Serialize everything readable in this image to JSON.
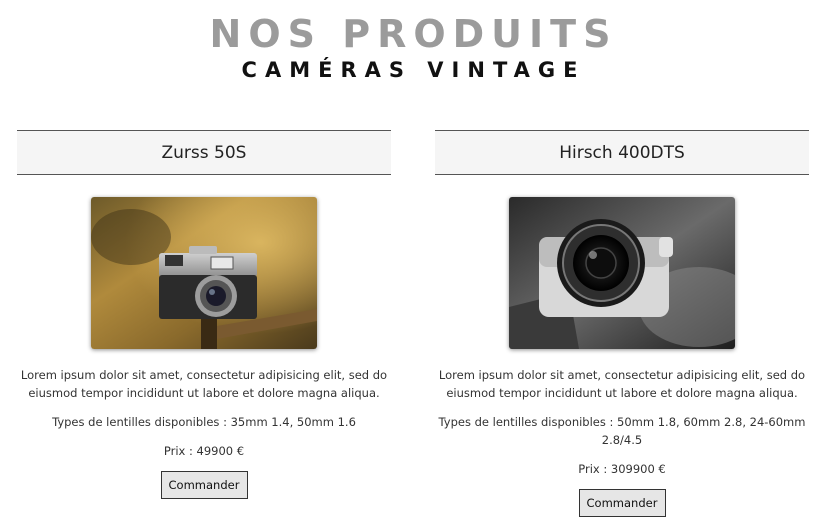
{
  "header": {
    "title": "NOS PRODUITS",
    "subtitle": "CAMÉRAS VINTAGE"
  },
  "products": [
    {
      "name": "Zurss 50S",
      "description_line1": "Lorem ipsum dolor sit amet, consectetur adipisicing elit, sed do",
      "description_line2": "eiusmod tempor incididunt ut labore et dolore magna aliqua.",
      "lenses": "Types de lentilles disponibles : 35mm 1.4, 50mm 1.6",
      "price": "Prix : 49900 €",
      "button": "Commander",
      "image": "vintage-camera-warm-photo"
    },
    {
      "name": "Hirsch 400DTS",
      "description_line1": "Lorem ipsum dolor sit amet, consectetur adipisicing elit, sed do",
      "description_line2": "eiusmod tempor incididunt ut labore et dolore magna aliqua.",
      "lenses": "Types de lentilles disponibles : 50mm 1.8, 60mm 2.8, 24-60mm 2.8/4.5",
      "price": "Prix : 309900 €",
      "button": "Commander",
      "image": "camera-lens-bw-photo"
    }
  ],
  "colors": {
    "title": "#9b9b9b",
    "subtitle": "#111111",
    "card_header_bg": "#f5f5f5",
    "button_bg": "#e6e6e6"
  }
}
